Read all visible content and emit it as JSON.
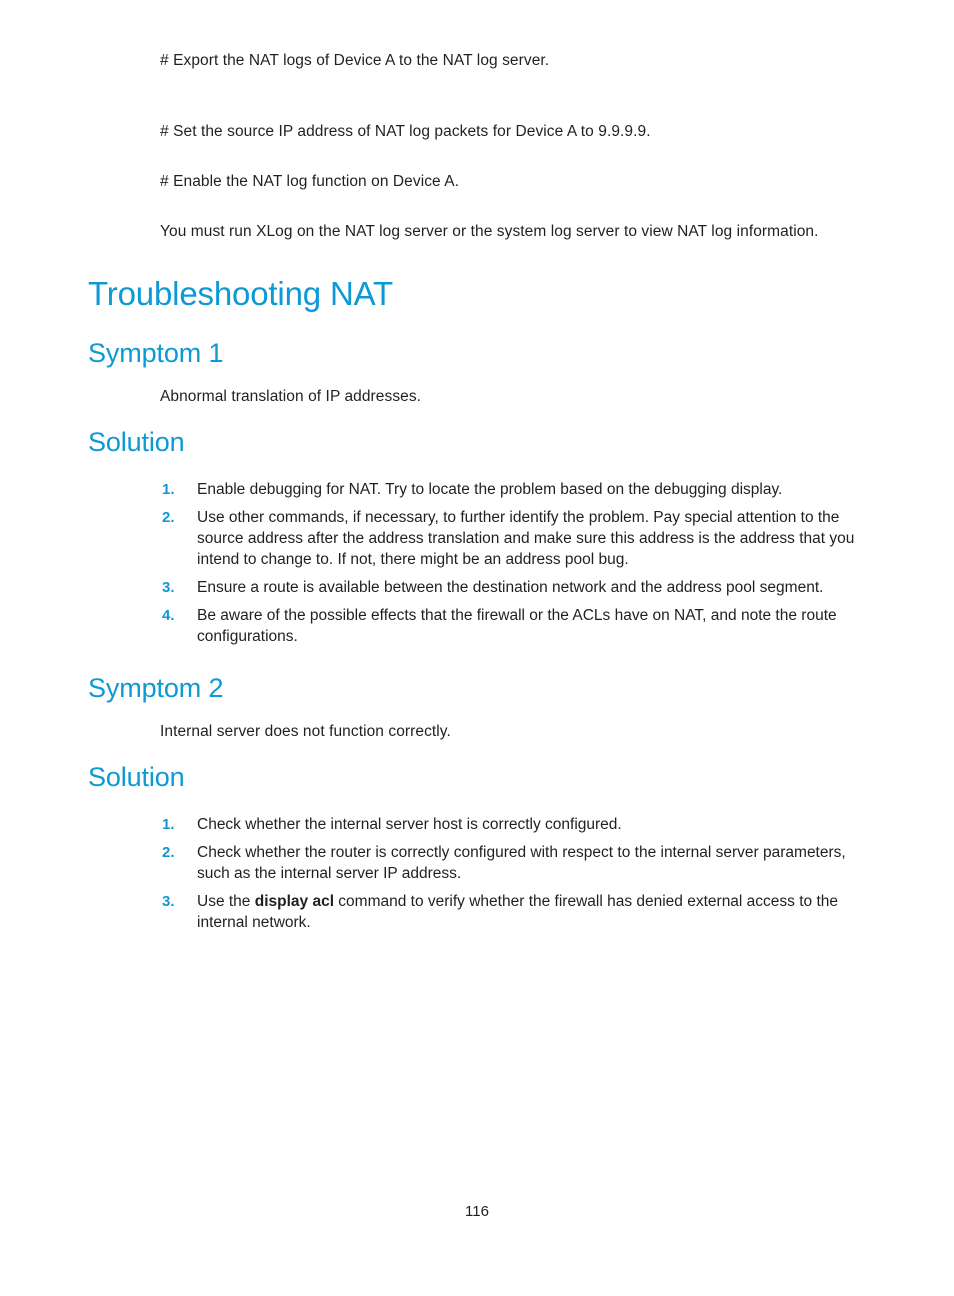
{
  "document": {
    "page_number": "116",
    "accent_color": "#0d9ad4",
    "body_color": "#231f20",
    "background_color": "#ffffff"
  },
  "intro": {
    "line_1": "# Export the NAT logs of Device A to the NAT log server.",
    "line_2": "# Set the source IP address of NAT log packets for Device A to 9.9.9.9.",
    "line_3": "# Enable the NAT log function on Device A.",
    "line_4": "You must run XLog on the NAT log server or the system log server to view NAT log information."
  },
  "title": "Troubleshooting NAT",
  "sections": [
    {
      "heading": "Symptom 1",
      "symptom_text": "Abnormal translation of IP addresses.",
      "solution_heading": "Solution",
      "steps": [
        {
          "number": "1.",
          "text": "Enable debugging for NAT. Try to locate the problem based on the debugging display."
        },
        {
          "number": "2.",
          "text": "Use other commands, if necessary, to further identify the problem. Pay special attention to the source address after the address translation and make sure this address is the address that you intend to change to. If not, there might be an address pool bug."
        },
        {
          "number": "3.",
          "text": "Ensure a route is available between the destination network and the address pool segment."
        },
        {
          "number": "4.",
          "text": "Be aware of the possible effects that the firewall or the ACLs have on NAT, and note the route configurations."
        }
      ]
    },
    {
      "heading": "Symptom 2",
      "symptom_text": "Internal server does not function correctly.",
      "solution_heading": "Solution",
      "steps": [
        {
          "number": "1.",
          "text": "Check whether the internal server host is correctly configured."
        },
        {
          "number": "2.",
          "text": "Check whether the router is correctly configured with respect to the internal server parameters, such as the internal server IP address."
        },
        {
          "number": "3.",
          "text_before": "Use the ",
          "command": "display acl",
          "text_after": " command to verify whether the firewall has denied external access to the internal network."
        }
      ]
    }
  ]
}
